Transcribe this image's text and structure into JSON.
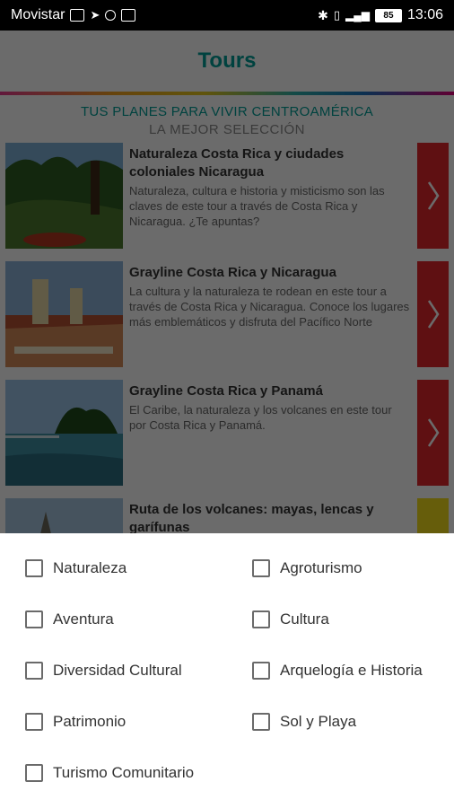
{
  "status": {
    "carrier": "Movistar",
    "battery": "85",
    "time": "13:06"
  },
  "header": {
    "title": "Tours"
  },
  "subtitles": {
    "line1": "TUS PLANES PARA VIVIR CENTROAMÉRICA",
    "line2": "LA MEJOR SELECCIÓN"
  },
  "tours": [
    {
      "title": "Naturaleza Costa Rica y ciudades coloniales Nicaragua",
      "description": "Naturaleza, cultura e historia y misticismo son las claves de este tour a través de Costa Rica y Nicaragua. ¿Te apuntas?"
    },
    {
      "title": "Grayline Costa Rica y Nicaragua",
      "description": "La cultura y la naturaleza te rodean en este tour a través de Costa Rica y Nicaragua. Conoce los lugares más emblemáticos y disfruta del Pacífico Norte"
    },
    {
      "title": "Grayline Costa Rica y Panamá",
      "description": "El Caribe, la naturaleza y los volcanes en este tour por Costa Rica y Panamá."
    },
    {
      "title": "Ruta de los volcanes: mayas, lencas y garífunas",
      "description": ""
    }
  ],
  "filters": [
    {
      "label": "Naturaleza",
      "checked": false
    },
    {
      "label": "Agroturismo",
      "checked": false
    },
    {
      "label": "Aventura",
      "checked": false
    },
    {
      "label": "Cultura",
      "checked": false
    },
    {
      "label": "Diversidad Cultural",
      "checked": false
    },
    {
      "label": "Arquelogía e Historia",
      "checked": false
    },
    {
      "label": "Patrimonio",
      "checked": false
    },
    {
      "label": "Sol y Playa",
      "checked": false
    },
    {
      "label": "Turismo Comunitario",
      "checked": false
    }
  ],
  "colors": {
    "accent": "#009e97",
    "go_button": "#e3262c",
    "go_button_alt": "#f4dd1c"
  }
}
